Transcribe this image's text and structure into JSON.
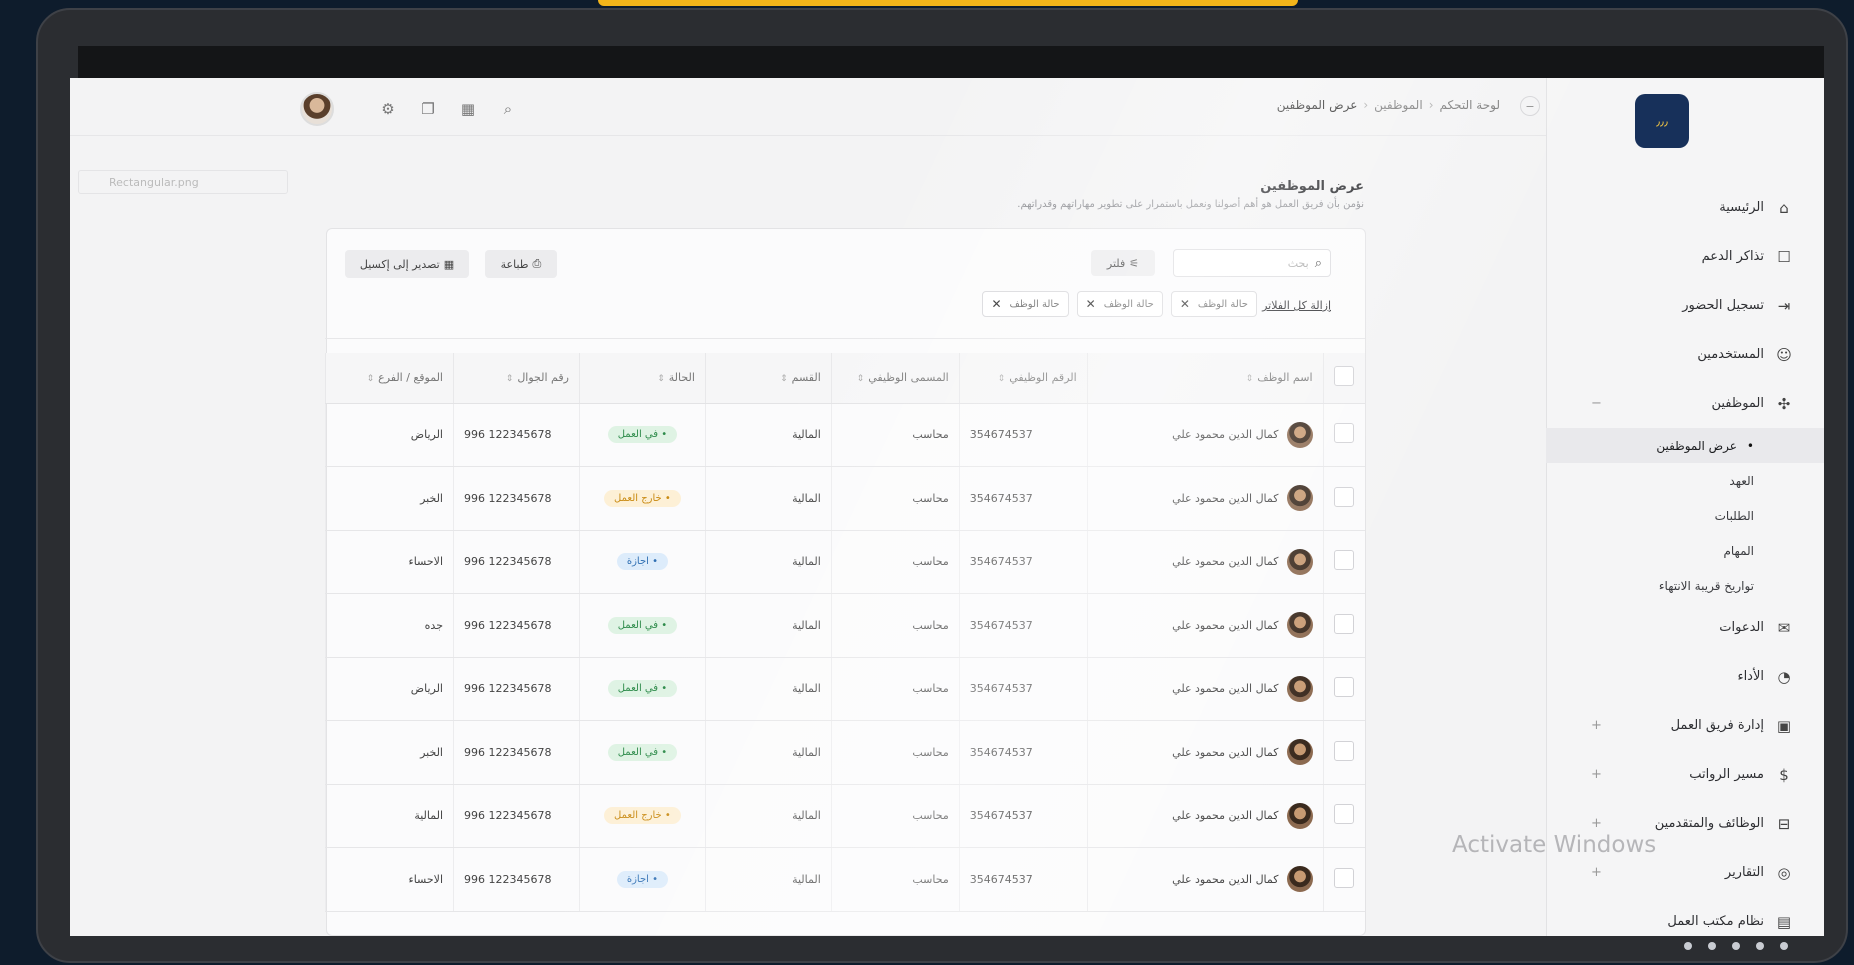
{
  "brand": {
    "logo_text": "٫٫٫"
  },
  "sidebar": {
    "items": [
      {
        "label": "الرئيسية",
        "icon": "home-icon",
        "glyph": "⌂"
      },
      {
        "label": "تذاكر الدعم",
        "icon": "ticket-icon",
        "glyph": "☐"
      },
      {
        "label": "تسجيل الحضور",
        "icon": "login-icon",
        "glyph": "⇥"
      },
      {
        "label": "المستخدمين",
        "icon": "user-icon",
        "glyph": "☺"
      },
      {
        "label": "الموظفين",
        "icon": "team-icon",
        "glyph": "✣"
      }
    ],
    "subitems": [
      {
        "label": "عرض الموظفين"
      },
      {
        "label": "العهد"
      },
      {
        "label": "الطلبات"
      },
      {
        "label": "المهام"
      },
      {
        "label": "تواريخ قريبة الانتهاء"
      }
    ],
    "items_after": [
      {
        "label": "الدعوات",
        "icon": "invitation-icon",
        "glyph": "✉"
      },
      {
        "label": "الأداء",
        "icon": "performance-icon",
        "glyph": "◔"
      },
      {
        "label": "إدارة فريق العمل",
        "icon": "team-manage-icon",
        "glyph": "▣"
      },
      {
        "label": "مسير الرواتب",
        "icon": "payroll-icon",
        "glyph": "$"
      },
      {
        "label": "الوظائف والمتقدمين",
        "icon": "briefcase-icon",
        "glyph": "⊟"
      },
      {
        "label": "التقارير",
        "icon": "reports-icon",
        "glyph": "◎"
      },
      {
        "label": "نظام مكتب العمل",
        "icon": "labor-office-icon",
        "glyph": "▤"
      }
    ]
  },
  "header": {
    "breadcrumb": [
      "لوحة التحكم",
      "الموظفين",
      "عرض الموظفين"
    ],
    "file_chip": "Rectangular.png"
  },
  "page": {
    "title": "عرض الموظفين",
    "subtitle": "نؤمن بأن فريق العمل هو أهم أصولنا ونعمل باستمرار على تطوير مهاراتهم وقدراتهم."
  },
  "toolbar": {
    "search_placeholder": "بحث",
    "filter_label": "فلتر",
    "clear_all_label": "إزالة كل الفلاتر",
    "chips": [
      "حالة الوظف",
      "حالة الوظف",
      "حالة الوظف"
    ],
    "print_label": "طباعة",
    "excel_label": "تصدير إلى إكسيل"
  },
  "table": {
    "columns": [
      "اسم الوظف",
      "الرقم الوظيفي",
      "المسمى الوظيفي",
      "القسم",
      "الحالة",
      "رقم الجوال",
      "الموقع / الفرع"
    ],
    "rows": [
      {
        "name": "كمال الدين محمود علي",
        "id": "354674537",
        "title": "محاسب",
        "dept": "المالية",
        "status": "في العمل",
        "status_color": "green",
        "phone": "996 122345678",
        "branch": "الرياض"
      },
      {
        "name": "كمال الدين محمود علي",
        "id": "354674537",
        "title": "محاسب",
        "dept": "المالية",
        "status": "خارج العمل",
        "status_color": "orange",
        "phone": "996 122345678",
        "branch": "الخبر"
      },
      {
        "name": "كمال الدين محمود علي",
        "id": "354674537",
        "title": "محاسب",
        "dept": "المالية",
        "status": "اجازة",
        "status_color": "blue",
        "phone": "996 122345678",
        "branch": "الاحساء"
      },
      {
        "name": "كمال الدين محمود علي",
        "id": "354674537",
        "title": "محاسب",
        "dept": "المالية",
        "status": "في العمل",
        "status_color": "green",
        "phone": "996 122345678",
        "branch": "جده"
      },
      {
        "name": "كمال الدين محمود علي",
        "id": "354674537",
        "title": "محاسب",
        "dept": "المالية",
        "status": "في العمل",
        "status_color": "green",
        "phone": "996 122345678",
        "branch": "الرياض"
      },
      {
        "name": "كمال الدين محمود علي",
        "id": "354674537",
        "title": "محاسب",
        "dept": "المالية",
        "status": "في العمل",
        "status_color": "green",
        "phone": "996 122345678",
        "branch": "الخبر"
      },
      {
        "name": "كمال الدين محمود علي",
        "id": "354674537",
        "title": "محاسب",
        "dept": "المالية",
        "status": "خارج العمل",
        "status_color": "orange",
        "phone": "996 122345678",
        "branch": "المالية"
      },
      {
        "name": "كمال الدين محمود علي",
        "id": "354674537",
        "title": "محاسب",
        "dept": "المالية",
        "status": "اجازة",
        "status_color": "blue",
        "phone": "996 122345678",
        "branch": "الاحساء"
      }
    ]
  },
  "overlay": {
    "watermark": "Activate Windows"
  },
  "colors": {
    "accent": "#f3b51a",
    "brand": "#17305a"
  }
}
